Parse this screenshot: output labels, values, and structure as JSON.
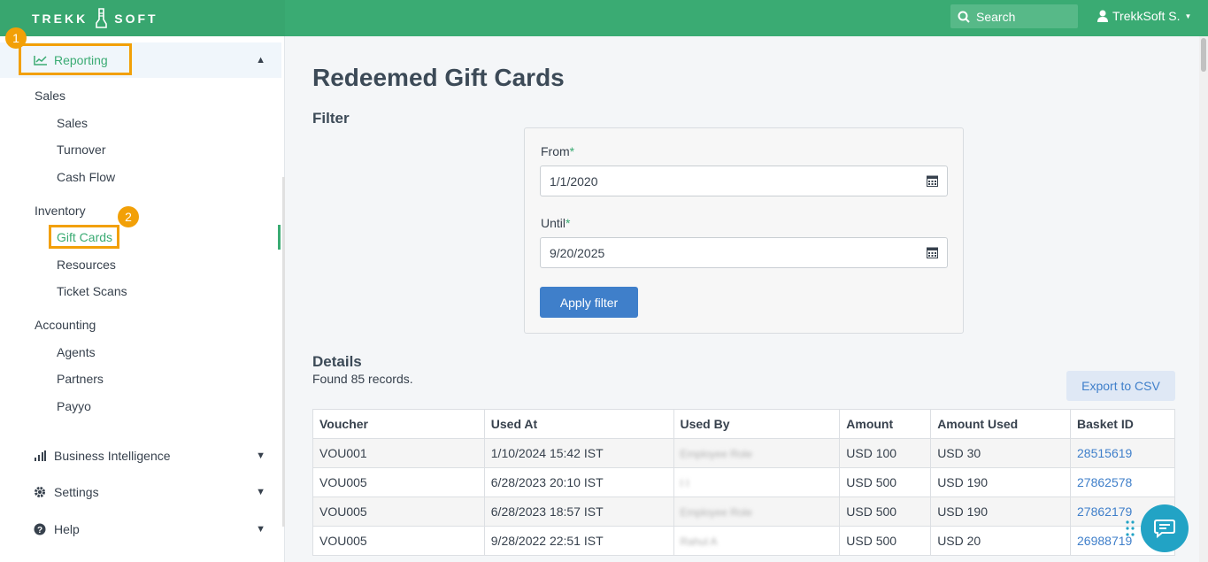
{
  "header": {
    "logo_left": "TREKK",
    "logo_right": "SOFT",
    "search_placeholder": "Search",
    "user_name": "TrekkSoft S."
  },
  "sidebar": {
    "reporting_label": "Reporting",
    "groups": [
      {
        "label": "Sales",
        "items": [
          "Sales",
          "Turnover",
          "Cash Flow"
        ]
      },
      {
        "label": "Inventory",
        "items": [
          "Gift Cards",
          "Resources",
          "Ticket Scans"
        ]
      },
      {
        "label": "Accounting",
        "items": [
          "Agents",
          "Partners",
          "Payyo"
        ]
      }
    ],
    "sections": [
      "Business Intelligence",
      "Settings",
      "Help"
    ]
  },
  "annotations": {
    "badge1": "1",
    "badge2": "2"
  },
  "main": {
    "title": "Redeemed Gift Cards",
    "filter_heading": "Filter",
    "from_label": "From",
    "from_value": "1/1/2020",
    "until_label": "Until",
    "until_value": "9/20/2025",
    "required_mark": "*",
    "apply_label": "Apply filter",
    "details_heading": "Details",
    "found_text": "Found 85 records.",
    "export_label": "Export to CSV"
  },
  "table": {
    "headers": [
      "Voucher",
      "Used At",
      "Used By",
      "Amount",
      "Amount Used",
      "Basket ID"
    ],
    "rows": [
      [
        "VOU001",
        "1/10/2024 15:42 IST",
        "Employee Role",
        "USD 100",
        "USD 30",
        "28515619"
      ],
      [
        "VOU005",
        "6/28/2023 20:10 IST",
        "I I",
        "USD 500",
        "USD 190",
        "27862578"
      ],
      [
        "VOU005",
        "6/28/2023 18:57 IST",
        "Employee Role",
        "USD 500",
        "USD 190",
        "27862179"
      ],
      [
        "VOU005",
        "9/28/2022 22:51 IST",
        "Rahul A",
        "USD 500",
        "USD 20",
        "26988719"
      ]
    ]
  },
  "colors": {
    "brand_green": "#3aab73",
    "link_blue": "#3f7fca",
    "highlight_orange": "#f2a007",
    "chat_teal": "#22a3c5"
  }
}
